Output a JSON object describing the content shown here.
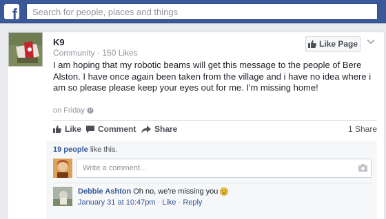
{
  "topbar": {
    "logo": "f",
    "search_placeholder": "Search for people, places and things"
  },
  "post": {
    "author": "K9",
    "meta": "Community · 150 Likes",
    "like_page_label": "Like Page",
    "text": "I am hoping that my robotic beams will get this message to the people of Bere Alston. I have once again been taken from the village and i have no idea where i am so please please keep your eyes out for me. I'm missing home!",
    "time": "on Friday",
    "time_icon": "globe-icon"
  },
  "actions": {
    "like": "Like",
    "comment": "Comment",
    "share": "Share",
    "share_count": "1 Share"
  },
  "ufi": {
    "likes_count": "19 people",
    "likes_suffix": "like this.",
    "comment_placeholder": "Write a comment..."
  },
  "comment": {
    "author": "Debbie Ashton",
    "text": "Oh no, we're missing you",
    "emoji": "sad-face",
    "timestamp": "January 31 at 10:47pm",
    "like": "Like",
    "reply": "Reply",
    "sep": "·"
  },
  "colors": {
    "brand": "#3b5998",
    "link": "#365899",
    "background": "#e9ebee"
  }
}
